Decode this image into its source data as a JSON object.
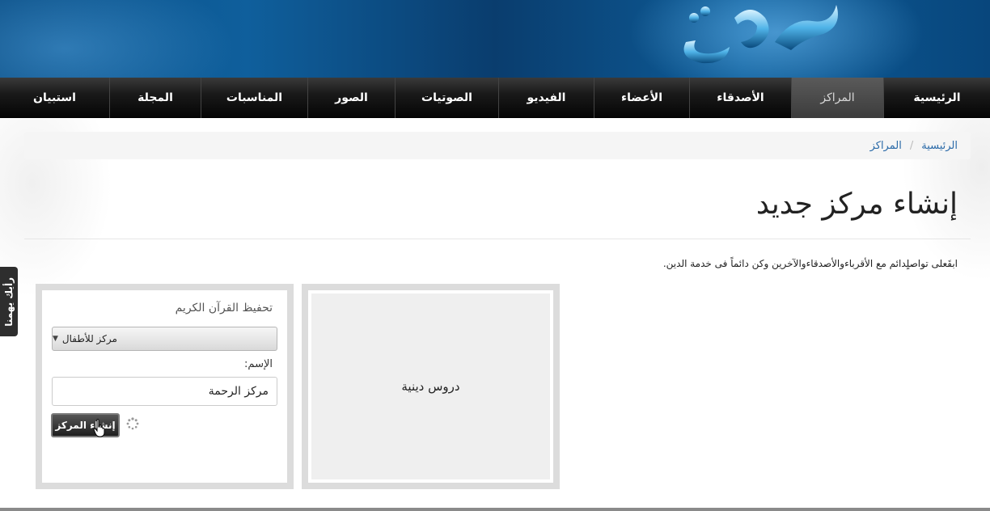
{
  "header": {
    "logo_alt": "logo"
  },
  "nav": {
    "items": [
      {
        "label": "الرئيسية",
        "active": false
      },
      {
        "label": "المراكز",
        "active": true
      },
      {
        "label": "الأصدقاء",
        "active": false
      },
      {
        "label": "الأعضاء",
        "active": false
      },
      {
        "label": "الفيديو",
        "active": false
      },
      {
        "label": "الصوتيات",
        "active": false
      },
      {
        "label": "الصور",
        "active": false
      },
      {
        "label": "المناسبات",
        "active": false
      },
      {
        "label": "المجلة",
        "active": false
      },
      {
        "label": "استبيان",
        "active": false
      }
    ]
  },
  "breadcrumb": {
    "home": "الرئيسية",
    "separator": "/",
    "current": "المراكز"
  },
  "page": {
    "title": "إنشاء مركز جديد",
    "intro": "ابقَعلى تواصلٍدائم مع الأقرباءوالأصدقاءوالآخرين وكن دائماً فى خدمة الدين."
  },
  "preview": {
    "label": "دروس دينية"
  },
  "form": {
    "heading": "تحفيظ القرآن الكريم",
    "dropdown_value": "مركز للأطفال",
    "name_label": "الإسم:",
    "name_value": "مركز الرحمة",
    "submit_label": "إنشاء المركز"
  },
  "feedback": {
    "label": "رأيك يهمنا"
  },
  "colors": {
    "banner": "#0d5c98",
    "nav": "#111111",
    "link": "#2a6aa8"
  }
}
